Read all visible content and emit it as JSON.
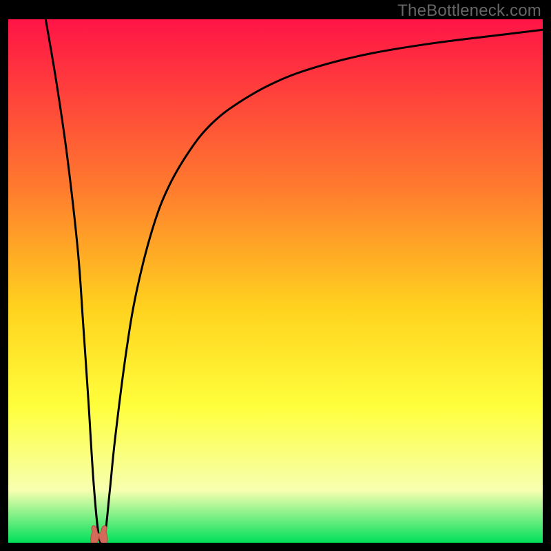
{
  "watermark": "TheBottleneck.com",
  "colors": {
    "background": "#000000",
    "curve": "#000000",
    "marker_fill": "#d46a5a",
    "marker_stroke": "#b94f3f",
    "gradient_top": "#ff1446",
    "gradient_mid1": "#ff7a2e",
    "gradient_mid2": "#ffd21e",
    "gradient_mid3": "#ffff3c",
    "gradient_mid4": "#f7ffb0",
    "gradient_bottom": "#00e05a"
  },
  "chart_data": {
    "type": "line",
    "title": "",
    "xlabel": "",
    "ylabel": "",
    "xlim": [
      0,
      100
    ],
    "ylim": [
      0,
      100
    ],
    "optimum_x": 17,
    "series": [
      {
        "name": "bottleneck-curve",
        "x": [
          7,
          9,
          11,
          13,
          14,
          15,
          16,
          17,
          18,
          19,
          20,
          22,
          24,
          27,
          30,
          34,
          38,
          43,
          50,
          58,
          68,
          80,
          92,
          100
        ],
        "values": [
          100,
          88,
          74,
          56,
          42,
          27,
          11,
          1,
          1,
          10,
          20,
          36,
          48,
          60,
          68,
          75,
          80,
          84,
          88,
          91,
          93.5,
          95.5,
          97,
          98
        ]
      }
    ],
    "marker": {
      "x": 17,
      "y": 1,
      "shape": "u-blob"
    }
  }
}
